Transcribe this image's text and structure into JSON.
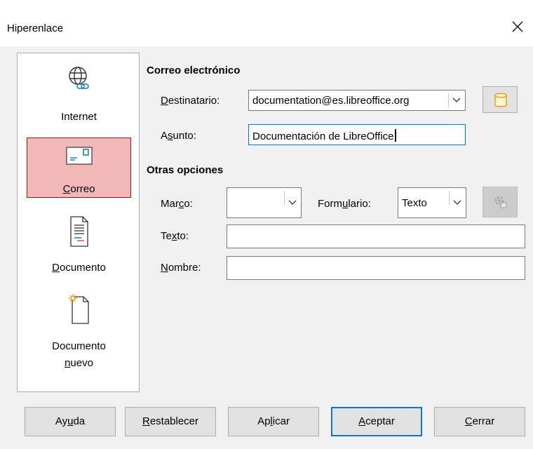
{
  "window": {
    "title": "Hiperenlace"
  },
  "sidebar": {
    "items": [
      {
        "label": "Internet",
        "icon": "globe-link-icon",
        "selected": false
      },
      {
        "label": "Correo",
        "icon": "envelope-icon",
        "selected": true
      },
      {
        "label": "Documento",
        "icon": "document-icon",
        "selected": false
      },
      {
        "label_line1": "Documento",
        "label_line2": "nuevo",
        "icon": "new-document-icon",
        "selected": false
      }
    ]
  },
  "mail": {
    "section_title": "Correo electrónico",
    "recipient_label_u": "D",
    "recipient_label_rest": "estinatario:",
    "recipient_value": "documentation@es.libreoffice.org",
    "subject_label_pre": "A",
    "subject_label_u": "s",
    "subject_label_rest": "unto:",
    "subject_value": "Documentación de LibreOffice",
    "datasource_icon": "database-icon"
  },
  "other": {
    "section_title": "Otras opciones",
    "frame_label_pre": "Mar",
    "frame_label_u": "c",
    "frame_label_rest": "o:",
    "frame_value": "",
    "form_label_pre": "Form",
    "form_label_u": "u",
    "form_label_rest": "lario:",
    "form_value": "Texto",
    "events_icon": "gear-events-icon",
    "text_label_pre": "Te",
    "text_label_u": "x",
    "text_label_rest": "to:",
    "text_value": "",
    "name_label_u": "N",
    "name_label_rest": "ombre:",
    "name_value": ""
  },
  "buttons": {
    "help_pre": "Ay",
    "help_u": "u",
    "help_rest": "da",
    "reset_u": "R",
    "reset_rest": "establecer",
    "apply_pre": "Ap",
    "apply_u": "l",
    "apply_rest": "icar",
    "ok_u": "A",
    "ok_rest": "ceptar",
    "close_u": "C",
    "close_rest": "errar"
  },
  "colors": {
    "selected_bg": "#f2b7b7",
    "selected_border": "#8b1a1a",
    "focus": "#0078d7"
  }
}
